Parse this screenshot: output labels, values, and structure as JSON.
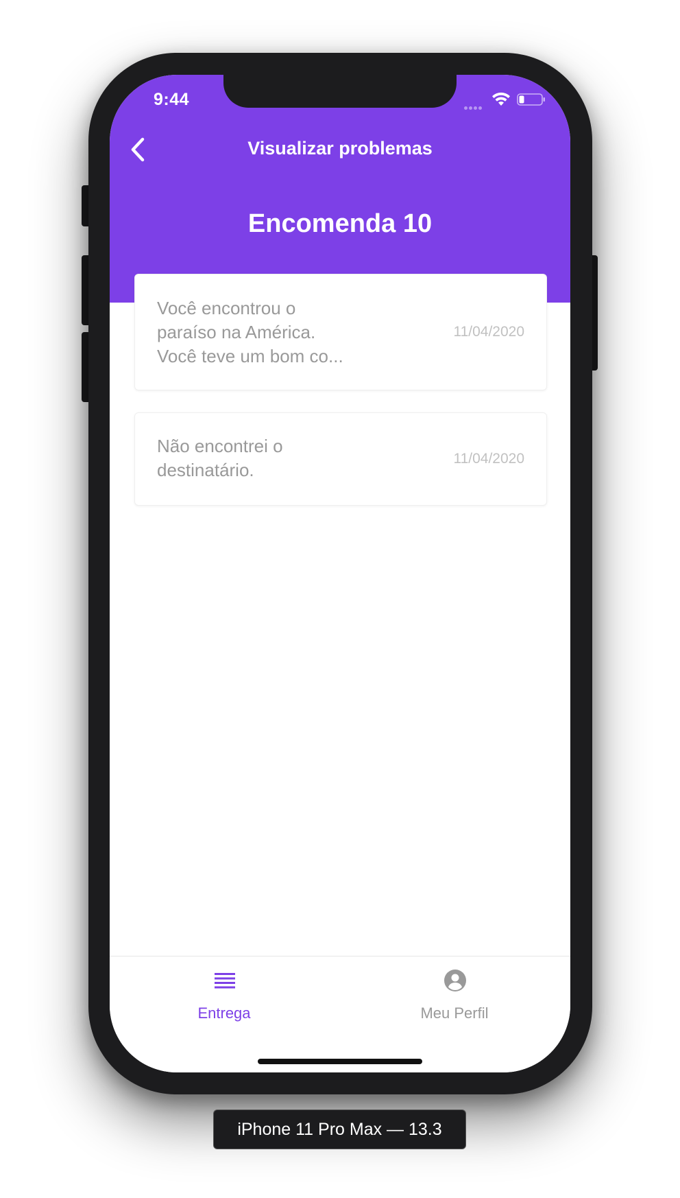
{
  "status_bar": {
    "time": "9:44"
  },
  "header": {
    "nav_title": "Visualizar problemas",
    "order_title": "Encomenda 10",
    "background_color": "#7d40e7"
  },
  "problems": [
    {
      "text": " Você encontrou o\nparaíso na América.\nVocê teve um bom co...",
      "date": "11/04/2020"
    },
    {
      "text": "Não encontrei o\ndestinatário.",
      "date": "11/04/2020"
    }
  ],
  "tabbar": {
    "items": [
      {
        "label": "Entrega",
        "icon": "list-icon",
        "active": true,
        "color": "#7d40e7"
      },
      {
        "label": "Meu Perfil",
        "icon": "account-circle-icon",
        "active": false,
        "color": "#999999"
      }
    ]
  },
  "simulator_label": "iPhone 11 Pro Max — 13.3"
}
